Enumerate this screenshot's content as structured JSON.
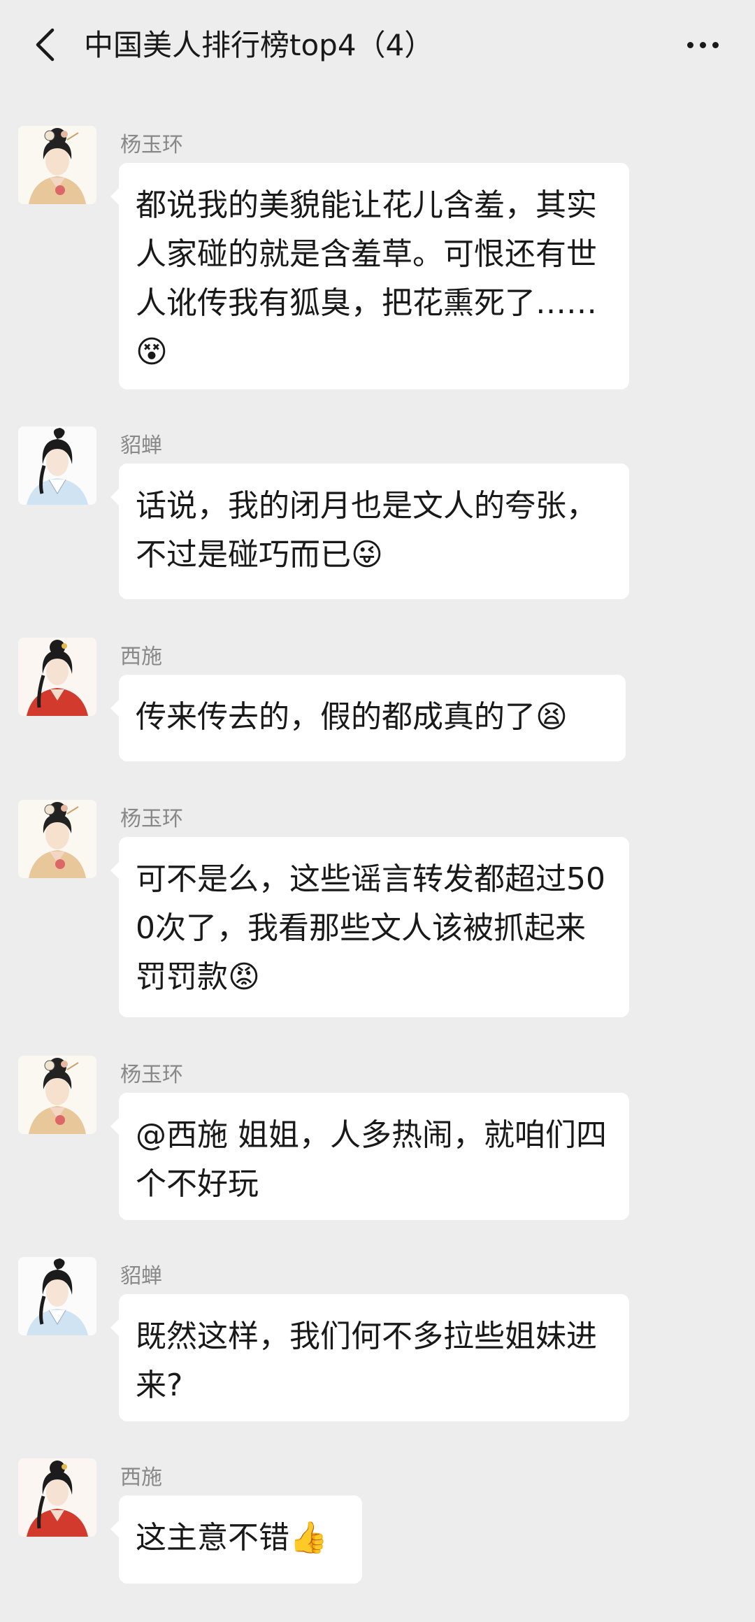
{
  "header": {
    "title": "中国美人排行榜top4（4）",
    "back_icon": "chevron-left-icon",
    "more_icon": "more-dots-icon"
  },
  "messages": [
    {
      "sender": "杨玉环",
      "text": "都说我的美貌能让花儿含羞，其实人家碰的就是含羞草。可恨还有世人讹传我有狐臭，把花熏死了……😵"
    },
    {
      "sender": "貂蝉",
      "text": "话说，我的闭月也是文人的夸张，不过是碰巧而已😜"
    },
    {
      "sender": "西施",
      "text": "传来传去的，假的都成真的了😫"
    },
    {
      "sender": "杨玉环",
      "text": "可不是么，这些谣言转发都超过500次了，我看那些文人该被抓起来罚罚款😡"
    },
    {
      "sender": "杨玉环",
      "text": "@西施 姐姐，人多热闹，就咱们四个不好玩"
    },
    {
      "sender": "貂蝉",
      "text": "既然这样，我们何不多拉些姐妹进来?"
    },
    {
      "sender": "西施",
      "text": "这主意不错👍"
    }
  ],
  "colors": {
    "background": "#ededed",
    "bubble": "#ffffff",
    "sender": "#888888",
    "text": "#191919"
  }
}
